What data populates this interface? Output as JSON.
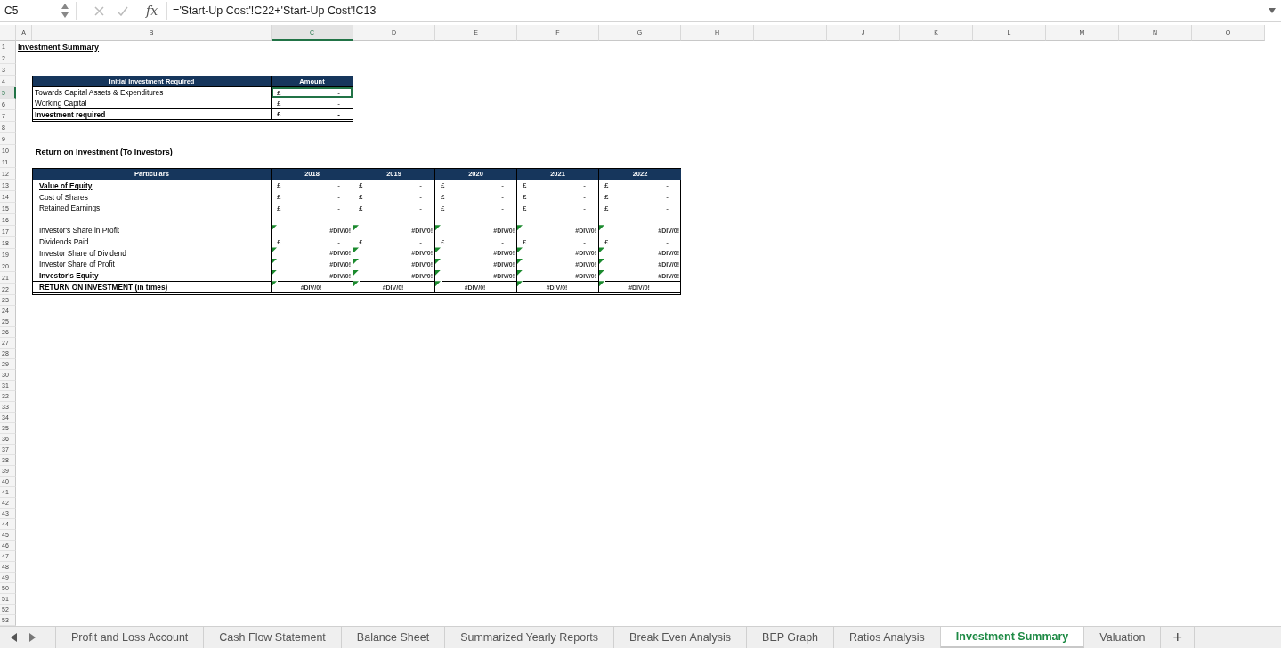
{
  "formula_bar": {
    "cell_ref": "C5",
    "function_label": "fx",
    "formula": "='Start-Up Cost'!C22+'Start-Up Cost'!C13"
  },
  "columns": [
    {
      "label": "A",
      "selected": false
    },
    {
      "label": "B",
      "selected": false
    },
    {
      "label": "C",
      "selected": true
    },
    {
      "label": "D",
      "selected": false
    },
    {
      "label": "E",
      "selected": false
    },
    {
      "label": "F",
      "selected": false
    },
    {
      "label": "G",
      "selected": false
    },
    {
      "label": "H",
      "selected": false
    },
    {
      "label": "I",
      "selected": false
    },
    {
      "label": "J",
      "selected": false
    },
    {
      "label": "K",
      "selected": false
    },
    {
      "label": "L",
      "selected": false
    },
    {
      "label": "M",
      "selected": false
    },
    {
      "label": "N",
      "selected": false
    },
    {
      "label": "O",
      "selected": false
    }
  ],
  "row_headers": [
    {
      "label": "1",
      "selected": false
    },
    {
      "label": "2",
      "selected": false
    },
    {
      "label": "3",
      "selected": false
    },
    {
      "label": "4",
      "selected": false
    },
    {
      "label": "5",
      "selected": true
    },
    {
      "label": "6",
      "selected": false
    },
    {
      "label": "7",
      "selected": false
    },
    {
      "label": "8",
      "selected": false
    },
    {
      "label": "9",
      "selected": false
    },
    {
      "label": "10",
      "selected": false
    },
    {
      "label": "11",
      "selected": false
    },
    {
      "label": "12",
      "selected": false
    },
    {
      "label": "13",
      "selected": false
    },
    {
      "label": "14",
      "selected": false
    },
    {
      "label": "15",
      "selected": false
    },
    {
      "label": "16",
      "selected": false
    },
    {
      "label": "17",
      "selected": false
    },
    {
      "label": "18",
      "selected": false
    },
    {
      "label": "19",
      "selected": false
    },
    {
      "label": "20",
      "selected": false
    },
    {
      "label": "21",
      "selected": false
    },
    {
      "label": "22",
      "selected": false
    },
    {
      "label": "23",
      "selected": false
    },
    {
      "label": "24",
      "selected": false
    },
    {
      "label": "25",
      "selected": false
    },
    {
      "label": "26",
      "selected": false
    },
    {
      "label": "27",
      "selected": false
    },
    {
      "label": "28",
      "selected": false
    },
    {
      "label": "29",
      "selected": false
    },
    {
      "label": "30",
      "selected": false
    },
    {
      "label": "31",
      "selected": false
    },
    {
      "label": "32",
      "selected": false
    },
    {
      "label": "33",
      "selected": false
    },
    {
      "label": "34",
      "selected": false
    },
    {
      "label": "35",
      "selected": false
    },
    {
      "label": "36",
      "selected": false
    },
    {
      "label": "37",
      "selected": false
    },
    {
      "label": "38",
      "selected": false
    },
    {
      "label": "39",
      "selected": false
    },
    {
      "label": "40",
      "selected": false
    },
    {
      "label": "41",
      "selected": false
    },
    {
      "label": "42",
      "selected": false
    },
    {
      "label": "43",
      "selected": false
    },
    {
      "label": "44",
      "selected": false
    },
    {
      "label": "45",
      "selected": false
    },
    {
      "label": "46",
      "selected": false
    },
    {
      "label": "47",
      "selected": false
    },
    {
      "label": "48",
      "selected": false
    },
    {
      "label": "49",
      "selected": false
    },
    {
      "label": "50",
      "selected": false
    },
    {
      "label": "51",
      "selected": false
    },
    {
      "label": "52",
      "selected": false
    },
    {
      "label": "53",
      "selected": false
    }
  ],
  "title": "Investment Summary",
  "investment_table": {
    "headers": [
      "Initial Investment Required",
      "Amount"
    ],
    "rows": [
      {
        "kind": "data",
        "label": "Towards Capital Assets & Expenditures",
        "bold": false,
        "currency": "£",
        "value": "-",
        "selected": true
      },
      {
        "kind": "data",
        "label": "Working Capital",
        "bold": false,
        "currency": "£",
        "value": "-",
        "selected": false
      },
      {
        "kind": "total",
        "label": "Investment required",
        "bold": true,
        "currency": "£",
        "value": "-",
        "selected": false
      }
    ]
  },
  "roi_title": "Return on Investment (To Investors)",
  "roi_table": {
    "headers": [
      "Particulars",
      "2018",
      "2019",
      "2020",
      "2021",
      "2022"
    ],
    "rows": [
      {
        "kind": "data",
        "label": "Value of Equity",
        "bold": true,
        "underline": true,
        "cells": [
          {
            "currency": "£",
            "value": "-",
            "flag": false
          },
          {
            "currency": "£",
            "value": "-",
            "flag": false
          },
          {
            "currency": "£",
            "value": "-",
            "flag": false
          },
          {
            "currency": "£",
            "value": "-",
            "flag": false
          },
          {
            "currency": "£",
            "value": "-",
            "flag": false
          }
        ]
      },
      {
        "kind": "data",
        "label": "Cost of Shares",
        "bold": false,
        "underline": false,
        "cells": [
          {
            "currency": "£",
            "value": "-",
            "flag": false
          },
          {
            "currency": "£",
            "value": "-",
            "flag": false
          },
          {
            "currency": "£",
            "value": "-",
            "flag": false
          },
          {
            "currency": "£",
            "value": "-",
            "flag": false
          },
          {
            "currency": "£",
            "value": "-",
            "flag": false
          }
        ]
      },
      {
        "kind": "data",
        "label": "Retained Earnings",
        "bold": false,
        "underline": false,
        "cells": [
          {
            "currency": "£",
            "value": "-",
            "flag": false
          },
          {
            "currency": "£",
            "value": "-",
            "flag": false
          },
          {
            "currency": "£",
            "value": "-",
            "flag": false
          },
          {
            "currency": "£",
            "value": "-",
            "flag": false
          },
          {
            "currency": "£",
            "value": "-",
            "flag": false
          }
        ]
      },
      {
        "kind": "blank"
      },
      {
        "kind": "data",
        "label": "Investor's Share in Profit",
        "bold": false,
        "underline": false,
        "cells": [
          {
            "value": "#DIV/0!",
            "flag": true
          },
          {
            "value": "#DIV/0!",
            "flag": true
          },
          {
            "value": "#DIV/0!",
            "flag": true
          },
          {
            "value": "#DIV/0!",
            "flag": true
          },
          {
            "value": "#DIV/0!",
            "flag": true
          }
        ]
      },
      {
        "kind": "data",
        "label": "Dividends Paid",
        "bold": false,
        "underline": false,
        "cells": [
          {
            "currency": "£",
            "value": "-",
            "flag": false
          },
          {
            "currency": "£",
            "value": "-",
            "flag": false
          },
          {
            "currency": "£",
            "value": "-",
            "flag": false
          },
          {
            "currency": "£",
            "value": "-",
            "flag": false
          },
          {
            "currency": "£",
            "value": "-",
            "flag": false
          }
        ]
      },
      {
        "kind": "data",
        "label": "Investor Share of Dividend",
        "bold": false,
        "underline": false,
        "cells": [
          {
            "value": "#DIV/0!",
            "flag": true
          },
          {
            "value": "#DIV/0!",
            "flag": true
          },
          {
            "value": "#DIV/0!",
            "flag": true
          },
          {
            "value": "#DIV/0!",
            "flag": true
          },
          {
            "value": "#DIV/0!",
            "flag": true
          }
        ]
      },
      {
        "kind": "data",
        "label": "Investor Share of Profit",
        "bold": false,
        "underline": false,
        "cells": [
          {
            "value": "#DIV/0!",
            "flag": true
          },
          {
            "value": "#DIV/0!",
            "flag": true
          },
          {
            "value": "#DIV/0!",
            "flag": true
          },
          {
            "value": "#DIV/0!",
            "flag": true
          },
          {
            "value": "#DIV/0!",
            "flag": true
          }
        ]
      },
      {
        "kind": "data",
        "label": "Investor's Equity",
        "bold": true,
        "underline": false,
        "cells": [
          {
            "value": "#DIV/0!",
            "flag": true
          },
          {
            "value": "#DIV/0!",
            "flag": true
          },
          {
            "value": "#DIV/0!",
            "flag": true
          },
          {
            "value": "#DIV/0!",
            "flag": true
          },
          {
            "value": "#DIV/0!",
            "flag": true
          }
        ]
      },
      {
        "kind": "total",
        "label": "RETURN ON INVESTMENT (in times)",
        "bold": true,
        "underline": false,
        "cells": [
          {
            "value": "#DIV/0!",
            "flag": true
          },
          {
            "value": "#DIV/0!",
            "flag": true
          },
          {
            "value": "#DIV/0!",
            "flag": true
          },
          {
            "value": "#DIV/0!",
            "flag": true
          },
          {
            "value": "#DIV/0!",
            "flag": true
          }
        ]
      }
    ]
  },
  "sheet_tabs": [
    {
      "label": "Profit and Loss Account",
      "selected": false
    },
    {
      "label": "Cash Flow Statement",
      "selected": false
    },
    {
      "label": "Balance Sheet",
      "selected": false
    },
    {
      "label": "Summarized Yearly Reports",
      "selected": false
    },
    {
      "label": "Break Even Analysis",
      "selected": false
    },
    {
      "label": "BEP Graph",
      "selected": false
    },
    {
      "label": "Ratios Analysis",
      "selected": false
    },
    {
      "label": "Investment Summary",
      "selected": true
    },
    {
      "label": "Valuation",
      "selected": false
    }
  ],
  "new_sheet_button": "+"
}
